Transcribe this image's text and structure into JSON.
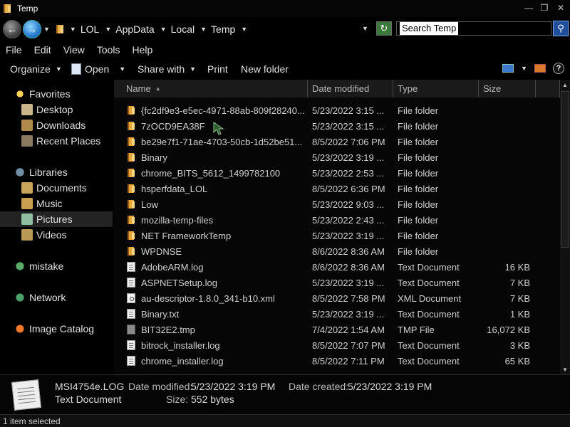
{
  "window": {
    "title": "Temp"
  },
  "address": {
    "breadcrumbs": [
      "LOL",
      "AppData",
      "Local",
      "Temp"
    ],
    "search_value": "Search Temp"
  },
  "menu": [
    "File",
    "Edit",
    "View",
    "Tools",
    "Help"
  ],
  "toolbar": {
    "organize": "Organize",
    "open": "Open",
    "share_with": "Share with",
    "print": "Print",
    "new_folder": "New folder"
  },
  "nav": {
    "favorites": "Favorites",
    "desktop": "Desktop",
    "downloads": "Downloads",
    "recent_places": "Recent Places",
    "libraries": "Libraries",
    "documents": "Documents",
    "music": "Music",
    "pictures": "Pictures",
    "videos": "Videos",
    "homegroup": "mistake",
    "network": "Network",
    "image_catalog": "Image Catalog"
  },
  "columns": {
    "name": "Name",
    "date_modified": "Date modified",
    "type": "Type",
    "size": "Size"
  },
  "rows": [
    {
      "icon": "folder",
      "name": "{fc2df9e3-e5ec-4971-88ab-809f28240...",
      "date": "5/23/2022 3:15 ...",
      "type": "File folder",
      "size": ""
    },
    {
      "icon": "folder",
      "name": "7zOCD9EA38F",
      "date": "5/23/2022 3:15 ...",
      "type": "File folder",
      "size": ""
    },
    {
      "icon": "folder",
      "name": "be29e7f1-71ae-4703-50cb-1d52be51...",
      "date": "8/5/2022 7:06 PM",
      "type": "File folder",
      "size": ""
    },
    {
      "icon": "folder",
      "name": "Binary",
      "date": "5/23/2022 3:19 ...",
      "type": "File folder",
      "size": ""
    },
    {
      "icon": "folder",
      "name": "chrome_BITS_5612_1499782100",
      "date": "5/23/2022 2:53 ...",
      "type": "File folder",
      "size": ""
    },
    {
      "icon": "folder",
      "name": "hsperfdata_LOL",
      "date": "8/5/2022 6:36 PM",
      "type": "File folder",
      "size": ""
    },
    {
      "icon": "folder",
      "name": "Low",
      "date": "5/23/2022 9:03 ...",
      "type": "File folder",
      "size": ""
    },
    {
      "icon": "folder",
      "name": "mozilla-temp-files",
      "date": "5/23/2022 2:43 ...",
      "type": "File folder",
      "size": ""
    },
    {
      "icon": "folder",
      "name": "NET FrameworkTemp",
      "date": "5/23/2022 3:19 ...",
      "type": "File folder",
      "size": ""
    },
    {
      "icon": "folder",
      "name": "WPDNSE",
      "date": "8/6/2022 8:36 AM",
      "type": "File folder",
      "size": ""
    },
    {
      "icon": "text",
      "name": "AdobeARM.log",
      "date": "8/6/2022 8:36 AM",
      "type": "Text Document",
      "size": "16 KB"
    },
    {
      "icon": "text",
      "name": "ASPNETSetup.log",
      "date": "5/23/2022 3:19 ...",
      "type": "Text Document",
      "size": "7 KB"
    },
    {
      "icon": "xml",
      "name": "au-descriptor-1.8.0_341-b10.xml",
      "date": "8/5/2022 7:58 PM",
      "type": "XML Document",
      "size": "7 KB"
    },
    {
      "icon": "text",
      "name": "Binary.txt",
      "date": "5/23/2022 3:19 ...",
      "type": "Text Document",
      "size": "1 KB"
    },
    {
      "icon": "tmp",
      "name": "BIT32E2.tmp",
      "date": "7/4/2022 1:54 AM",
      "type": "TMP File",
      "size": "16,072 KB"
    },
    {
      "icon": "text",
      "name": "bitrock_installer.log",
      "date": "8/5/2022 7:07 PM",
      "type": "Text Document",
      "size": "3 KB"
    },
    {
      "icon": "text",
      "name": "chrome_installer.log",
      "date": "8/5/2022 7:11 PM",
      "type": "Text Document",
      "size": "65 KB"
    }
  ],
  "details": {
    "filename": "MSI4754e.LOG",
    "filetype": "Text Document",
    "date_modified_label": "Date modified:",
    "date_modified": "5/23/2022 3:19 PM",
    "date_created_label": "Date created:",
    "date_created": "5/23/2022 3:19 PM",
    "size_label": "Size:",
    "size": "552 bytes"
  },
  "status": {
    "text": "1 item selected"
  },
  "icons": {
    "back": "back-arrow-icon",
    "forward": "forward-arrow-icon",
    "refresh": "refresh-icon",
    "search": "search-icon",
    "help": "help-icon"
  }
}
